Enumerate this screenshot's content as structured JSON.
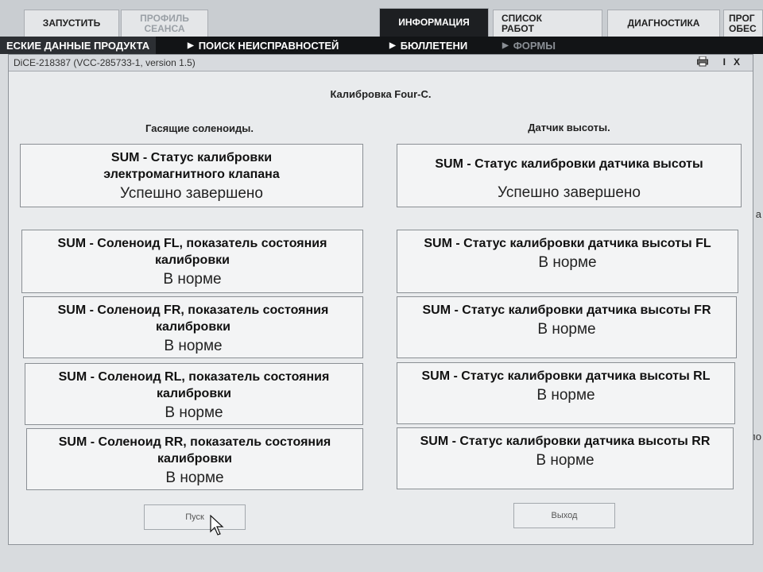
{
  "tabs": [
    {
      "label": "ЗАПУСТИТЬ"
    },
    {
      "label": "ПРОФИЛЬ\nСЕАНСА"
    },
    {
      "label": "ИНФОРМАЦИЯ"
    },
    {
      "label": "СПИСОК\nРАБОТ"
    },
    {
      "label": "ДИАГНОСТИКА"
    },
    {
      "label": "ПРОГ\nОБЕС"
    }
  ],
  "subnav": [
    {
      "label": "ЕСКИЕ ДАННЫЕ ПРОДУКТА"
    },
    {
      "label": "ПОИСК НЕИСПРАВНОСТЕЙ"
    },
    {
      "label": "БЮЛЛЕТЕНИ"
    },
    {
      "label": "ФОРМЫ"
    }
  ],
  "edge_text": [
    "а",
    "кло"
  ],
  "dialog": {
    "title": "DiCE-218387  (VCC-285733-1, version 1.5)",
    "heading": "Калибровка Four-C.",
    "left_header": "Гасящие соленоиды.",
    "right_header": "Датчик высоты.",
    "left_cards": [
      {
        "caption": "SUM - Статус калибровки электромагнитного клапана",
        "value": "Успешно завершено"
      },
      {
        "caption": "SUM - Соленоид FL, показатель состояния калибровки",
        "value": "В норме"
      },
      {
        "caption": "SUM - Соленоид FR, показатель состояния калибровки",
        "value": "В норме"
      },
      {
        "caption": "SUM - Соленоид RL, показатель состояния калибровки",
        "value": "В норме"
      },
      {
        "caption": "SUM - Соленоид RR, показатель состояния калибровки",
        "value": "В норме"
      }
    ],
    "right_cards": [
      {
        "caption": "SUM - Статус калибровки датчика высоты",
        "value": "Успешно завершено"
      },
      {
        "caption": "SUM - Статус калибровки датчика высоты FL",
        "value": "В норме"
      },
      {
        "caption": "SUM - Статус калибровки датчика высоты FR",
        "value": "В норме"
      },
      {
        "caption": "SUM - Статус калибровки датчика высоты RL",
        "value": "В норме"
      },
      {
        "caption": "SUM - Статус калибровки датчика высоты RR",
        "value": "В норме"
      }
    ],
    "start_label": "Пуск",
    "exit_label": "Выход"
  },
  "icons": {
    "print": "printer-icon",
    "info": "info-icon",
    "close": "close-icon",
    "cursor": "mouse-pointer-icon"
  }
}
